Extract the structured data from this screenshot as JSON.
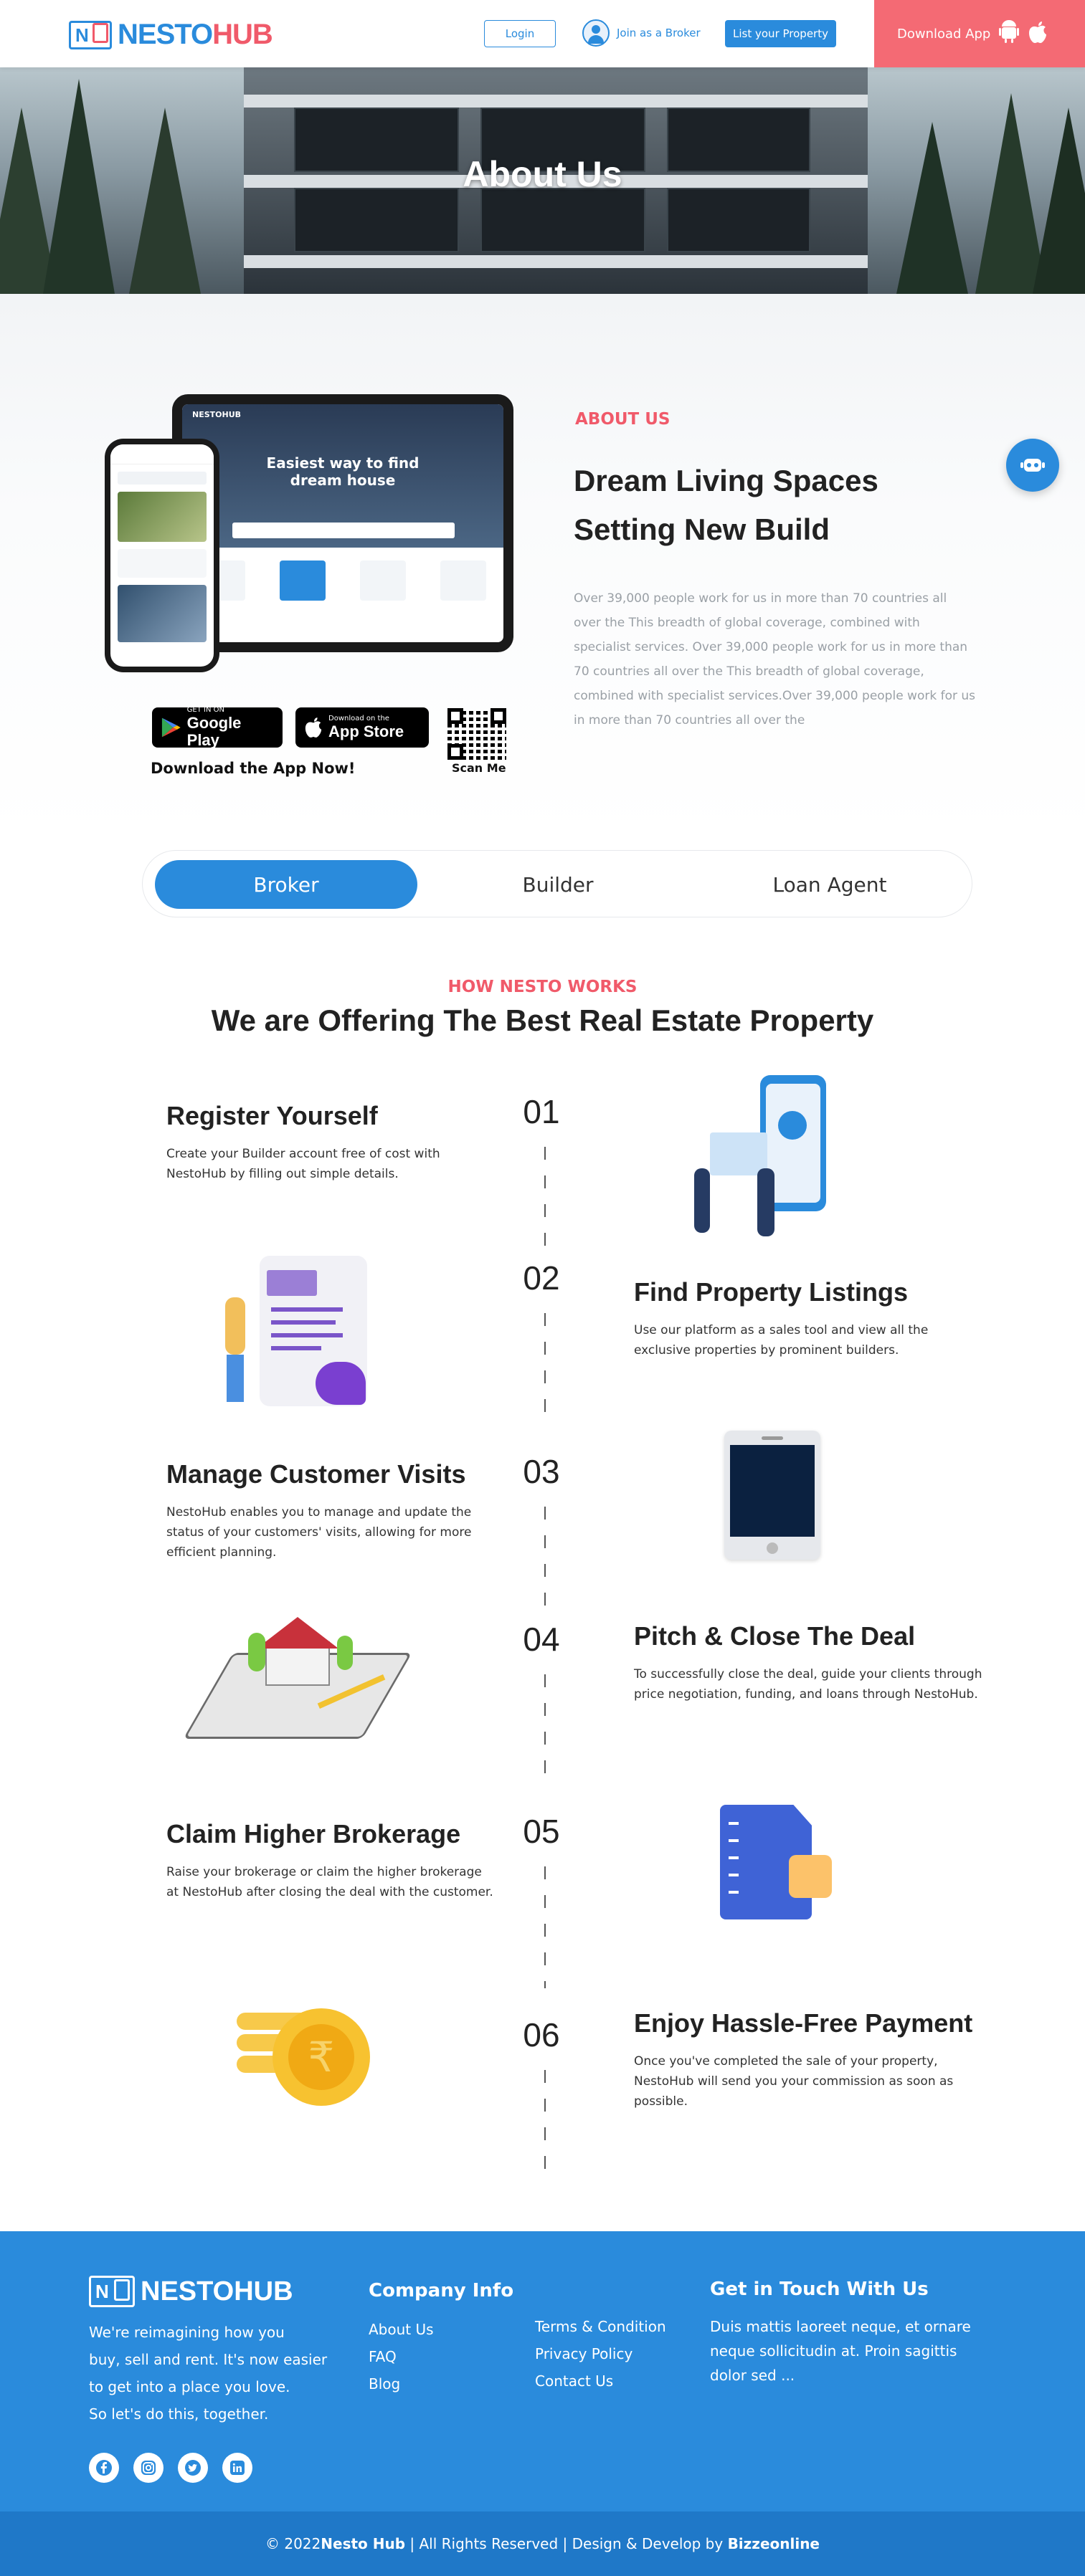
{
  "header": {
    "brand_left": "NESTO",
    "brand_right": "HUB",
    "login": "Login",
    "broker": "Join as a Broker",
    "list": "List your Property",
    "download": "Download App"
  },
  "hero": {
    "title": "About Us"
  },
  "about": {
    "label": "ABOUT US",
    "title_line1": "Dream Living Spaces",
    "title_line2": "Setting New Build",
    "body": "Over 39,000 people work for us in more than 70 countries all over the This breadth of global coverage, combined with specialist services. Over 39,000 people work for us in more than 70 countries all over the This breadth of global coverage, combined with specialist services.Over 39,000 people work for us in more than 70 countries all over the",
    "google_small": "GET IN ON",
    "google_big": "Google Play",
    "apple_small": "Download on the",
    "apple_big": "App Store",
    "download_now": "Download the App Now!",
    "scan_me": "Scan Me",
    "mock_title": "Easiest way to find dream house",
    "mock_brand": "NESTOHUB"
  },
  "tabs": [
    "Broker",
    "Builder",
    "Loan Agent"
  ],
  "works": {
    "label": "HOW NESTO WORKS",
    "title": "We are Offering The Best Real Estate Property",
    "steps": [
      {
        "num": "01",
        "title": "Register Yourself",
        "text": "Create your Builder account free of cost with NestoHub by filling out simple details."
      },
      {
        "num": "02",
        "title": "Find Property Listings",
        "text": "Use our platform as a sales tool and view all the exclusive properties by prominent builders."
      },
      {
        "num": "03",
        "title": "Manage Customer Visits",
        "text": "NestoHub enables you to manage and update the status of your customers' visits, allowing for more efficient planning."
      },
      {
        "num": "04",
        "title": "Pitch & Close The Deal",
        "text": "To successfully close the deal, guide your clients through price negotiation, funding, and loans through NestoHub."
      },
      {
        "num": "05",
        "title": "Claim Higher Brokerage",
        "text": "Raise your brokerage or claim the higher brokerage at NestoHub after closing the deal with the customer."
      },
      {
        "num": "06",
        "title": "Enjoy Hassle-Free Payment",
        "text": "Once you've completed the sale of your property, NestoHub will send you your commission as soon as possible."
      }
    ]
  },
  "footer": {
    "brand": "NESTOHUB",
    "tagline_1": "We're reimagining how you",
    "tagline_2": "buy, sell and rent. It's now easier",
    "tagline_3": "to get into a place you love.",
    "tagline_4": "So let's do this, together.",
    "company_title": "Company Info",
    "links_a": [
      "About Us",
      "FAQ",
      "Blog"
    ],
    "links_b": [
      "Terms & Condition",
      "Privacy Policy",
      "Contact Us"
    ],
    "touch_title": "Get in Touch With Us",
    "touch_text": "Duis mattis laoreet neque, et ornare neque sollicitudin at. Proin sagittis dolor sed ...",
    "copy_prefix": "© 2022 ",
    "copy_brand": "Nesto Hub",
    "copy_mid": " | All Rights Reserved | Design & Develop by ",
    "copy_dev": "Bizzeonline"
  }
}
